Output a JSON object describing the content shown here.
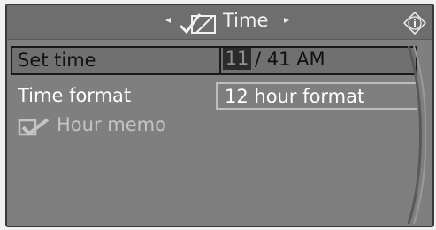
{
  "header": {
    "title": "Time",
    "left_arrow": "◂",
    "right_arrow": "▸",
    "icon": "clock-settings-icon",
    "info_icon": "info-icon"
  },
  "rows": [
    {
      "label": "Set time",
      "hour": "11",
      "rest": "/ 41 AM",
      "selected": true
    },
    {
      "label": "Time format",
      "value": "12 hour format"
    },
    {
      "label": "Hour memo",
      "icon": "checkmark-icon",
      "disabled": true
    }
  ],
  "colors": {
    "screen_bg": "#7f7f7f",
    "header_bg": "#6e6e6e",
    "text": "#ffffff",
    "selected_text": "#111111",
    "disabled_text": "#c4c4c4"
  }
}
